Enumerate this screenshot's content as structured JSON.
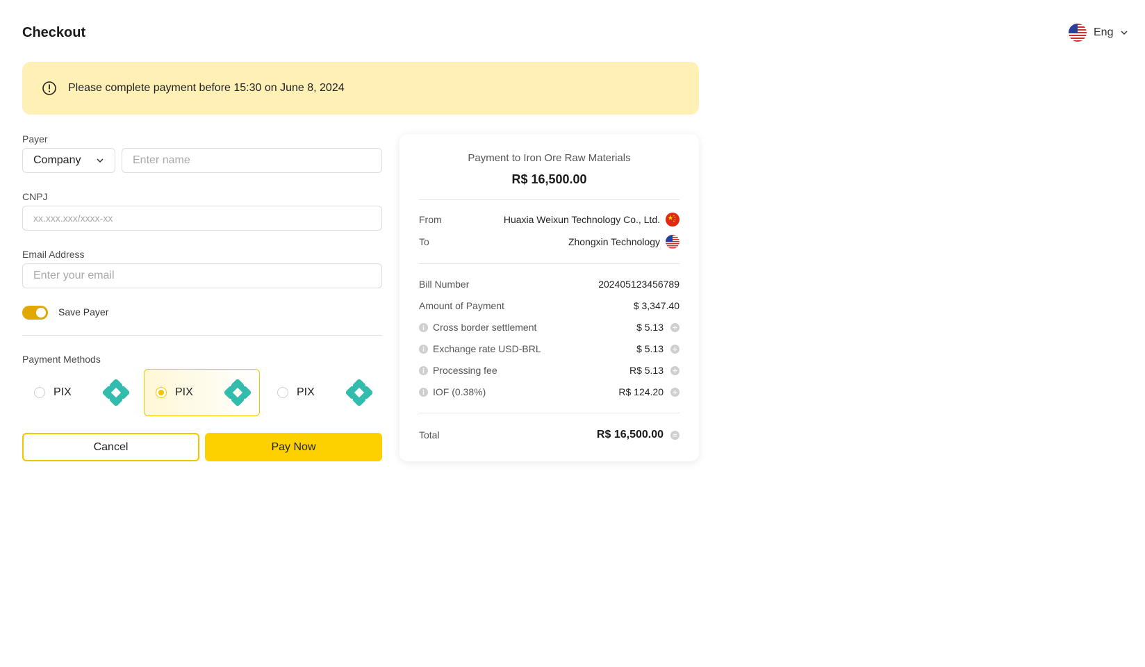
{
  "header": {
    "title": "Checkout",
    "language": "Eng"
  },
  "notice": {
    "text": "Please complete payment before 15:30 on June 8, 2024"
  },
  "form": {
    "payer_label": "Payer",
    "payer_type": "Company",
    "name_placeholder": "Enter name",
    "cnpj_label": "CNPJ",
    "cnpj_placeholder": "xx.xxx.xxx/xxxx-xx",
    "email_label": "Email Address",
    "email_placeholder": "Enter your email",
    "save_payer_label": "Save Payer",
    "save_payer_on": true
  },
  "payment_methods": {
    "label": "Payment Methods",
    "options": [
      {
        "name": "PIX",
        "selected": false
      },
      {
        "name": "PIX",
        "selected": true
      },
      {
        "name": "PIX",
        "selected": false
      }
    ]
  },
  "actions": {
    "cancel_label": "Cancel",
    "pay_label": "Pay Now"
  },
  "summary": {
    "subtitle": "Payment to Iron Ore Raw Materials",
    "amount": "R$ 16,500.00",
    "from_label": "From",
    "from_value": "Huaxia Weixun Technology Co., Ltd.",
    "to_label": "To",
    "to_value": "Zhongxin Technology",
    "bill_number_label": "Bill Number",
    "bill_number_value": "202405123456789",
    "amount_of_payment_label": "Amount of Payment",
    "amount_of_payment_value": "$ 3,347.40",
    "fees": [
      {
        "label": "Cross border settlement",
        "value": "$ 5.13"
      },
      {
        "label": "Exchange rate USD-BRL",
        "value": "$ 5.13"
      },
      {
        "label": "Processing fee",
        "value": "R$ 5.13"
      },
      {
        "label": "IOF (0.38%)",
        "value": "R$ 124.20"
      }
    ],
    "total_label": "Total",
    "total_value": "R$ 16,500.00"
  },
  "colors": {
    "accent": "#fdd100",
    "toggle": "#e0a800",
    "notice_bg": "#fff0b6",
    "pix_teal": "#32bcad"
  },
  "icons": {
    "language_flag": "us-flag-icon",
    "from_flag": "china-flag-icon",
    "to_flag": "us-flag-icon",
    "payment_logo": "pix-logo-icon"
  }
}
